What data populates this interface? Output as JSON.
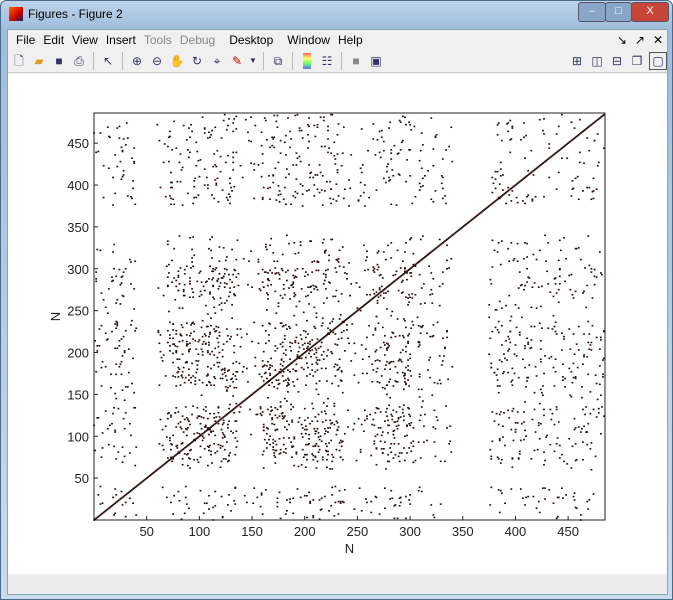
{
  "window": {
    "title": "Figures - Figure 2",
    "minimize": "–",
    "maximize": "□",
    "close": "X"
  },
  "menu": {
    "items": [
      "File",
      "Edit",
      "View",
      "Insert",
      "Tools",
      "Debug",
      "Desktop",
      "Window",
      "Help"
    ],
    "disabled": [
      "Tools",
      "Debug"
    ],
    "right": [
      "↘",
      "↗",
      "✕"
    ]
  },
  "toolbar": {
    "icons": [
      "new-figure",
      "open-file",
      "save",
      "print",
      "edit-plot",
      "zoom-in",
      "zoom-out",
      "pan",
      "rotate-3d",
      "data-cursor",
      "brush",
      "link-plot",
      "colorbar",
      "legend",
      "hide-plot-tools",
      "show-plot-tools"
    ],
    "layout_icons": [
      "tile-grid",
      "tile-columns",
      "tile-rows",
      "float",
      "maximize"
    ]
  },
  "chart_data": {
    "type": "scatter",
    "description": "sparsity pattern (spy plot) of a symmetric matrix",
    "xlabel": "N",
    "ylabel": "N",
    "xlim": [
      0,
      485
    ],
    "ylim": [
      0,
      486
    ],
    "xticks": [
      50,
      100,
      150,
      200,
      250,
      300,
      350,
      400,
      450
    ],
    "yticks": [
      50,
      100,
      150,
      200,
      250,
      300,
      350,
      400,
      450
    ],
    "n": 485,
    "dense_bands": [
      [
        70,
        135
      ],
      [
        160,
        235
      ],
      [
        265,
        300
      ]
    ],
    "line_rows": [
      20,
      28,
      40,
      300,
      310,
      385,
      395,
      410,
      425,
      440,
      455,
      470
    ],
    "marker_color": "#2a0a0a"
  }
}
